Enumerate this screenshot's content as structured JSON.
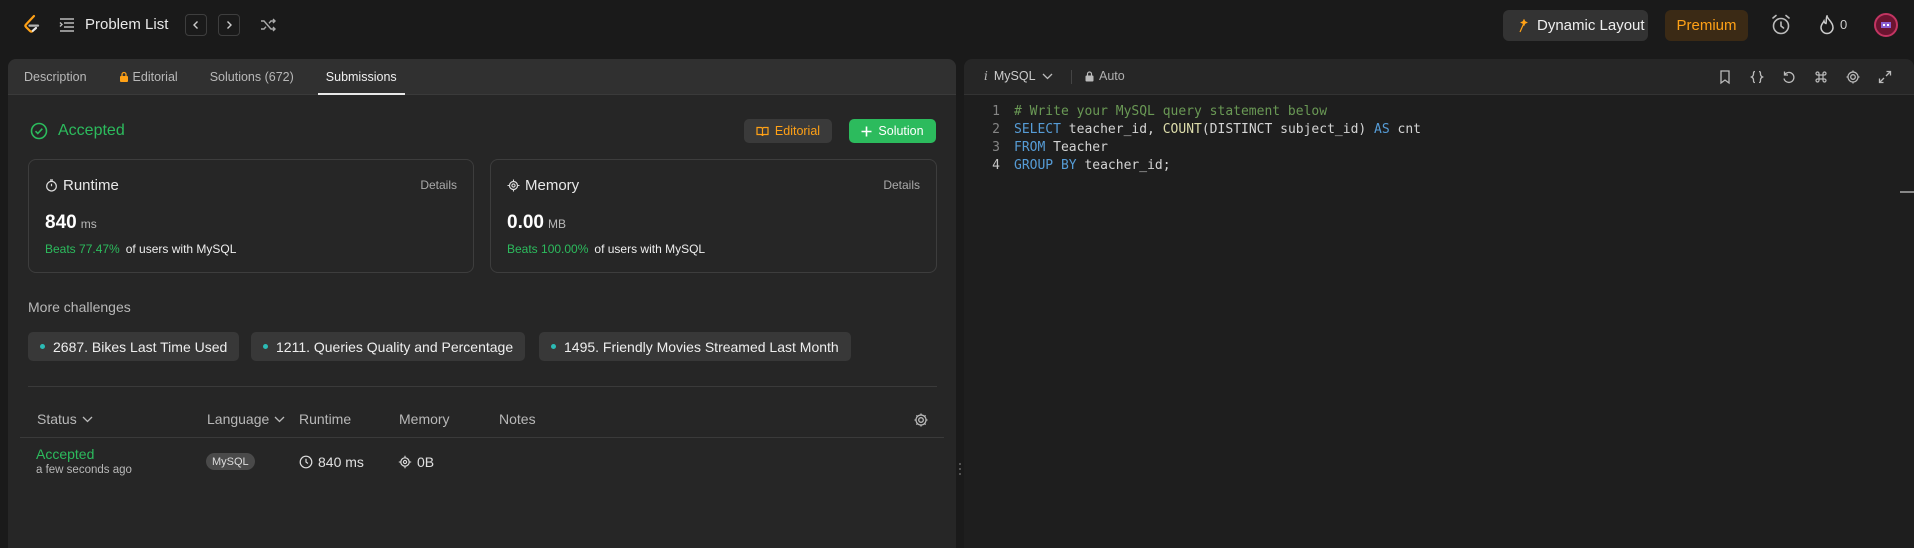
{
  "topbar": {
    "problem_list": "Problem List",
    "dynamic_layout": "Dynamic Layout",
    "premium": "Premium",
    "streak_count": "0",
    "accent": "#ffa116"
  },
  "left": {
    "tabs": [
      {
        "label": "Description"
      },
      {
        "label": "Editorial"
      },
      {
        "label": "Solutions (672)"
      },
      {
        "label": "Submissions"
      }
    ],
    "status": "Accepted",
    "editorial_btn": "Editorial",
    "solution_btn": "Solution",
    "runtime": {
      "title": "Runtime",
      "details": "Details",
      "value": "840",
      "unit": "ms",
      "beats": "Beats 77.47%",
      "beats_suffix": "of users with MySQL"
    },
    "memory": {
      "title": "Memory",
      "details": "Details",
      "value": "0.00",
      "unit": "MB",
      "beats": "Beats 100.00%",
      "beats_suffix": "of users with MySQL"
    },
    "more_challenges": "More challenges",
    "challenges": [
      "2687. Bikes Last Time Used",
      "1211. Queries Quality and Percentage",
      "1495. Friendly Movies Streamed Last Month"
    ],
    "table": {
      "headers": [
        "Status",
        "Language",
        "Runtime",
        "Memory",
        "Notes"
      ],
      "rows": [
        {
          "status": "Accepted",
          "time": "a few seconds ago",
          "language": "MySQL",
          "runtime": "840 ms",
          "memory": "0B"
        }
      ]
    },
    "success_color": "#2cbb5d"
  },
  "editor": {
    "language": "MySQL",
    "mode": "Auto",
    "lines": [
      "1",
      "2",
      "3",
      "4"
    ]
  }
}
